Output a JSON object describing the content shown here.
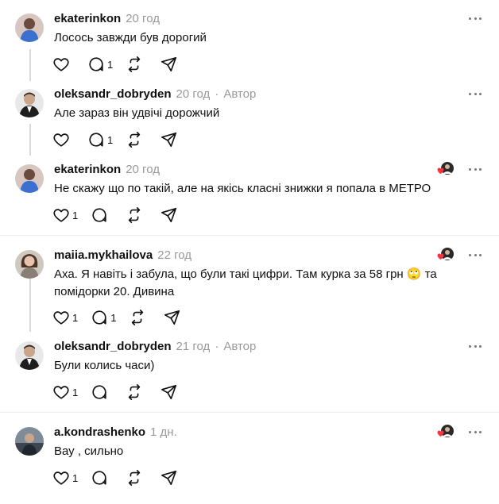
{
  "posts": [
    {
      "username": "ekaterinkon",
      "time": "20 год",
      "author_label": "",
      "text": "Лосось завжди був дорогий",
      "like_count": "",
      "reply_count": "1",
      "avatar_color": "#3b6fd0",
      "liked_by_author": false
    },
    {
      "username": "oleksandr_dobryden",
      "time": "20 год",
      "author_label": "Автор",
      "text": "Але зараз він удвічі дорожчий",
      "like_count": "",
      "reply_count": "1",
      "avatar_color": "#2a2a2a",
      "liked_by_author": false
    },
    {
      "username": "ekaterinkon",
      "time": "20 год",
      "author_label": "",
      "text": "Не скажу що по такій, але на якісь класні знижки я попала в МЕТРО",
      "like_count": "1",
      "reply_count": "",
      "avatar_color": "#3b6fd0",
      "liked_by_author": true
    },
    {
      "username": "maiia.mykhailova",
      "time": "22 год",
      "author_label": "",
      "text": "Аха. Я навіть і забула, що були такі цифри. Там курка за 58 грн 🙄 та помідорки 20. Дивина",
      "like_count": "1",
      "reply_count": "1",
      "avatar_color": "#8a7f74",
      "liked_by_author": true
    },
    {
      "username": "oleksandr_dobryden",
      "time": "21 год",
      "author_label": "Автор",
      "text": "Були колись часи)",
      "like_count": "1",
      "reply_count": "",
      "avatar_color": "#2a2a2a",
      "liked_by_author": false
    },
    {
      "username": "a.kondrashenko",
      "time": "1 дн.",
      "author_label": "",
      "text": "Вау , сильно",
      "like_count": "1",
      "reply_count": "",
      "avatar_color": "#4a5560",
      "liked_by_author": true
    }
  ],
  "separator_dot": "·",
  "icons": {
    "like": "heart-icon",
    "reply": "comment-bubble-icon",
    "repost": "repost-icon",
    "share": "send-icon",
    "more": "more-options-icon"
  }
}
